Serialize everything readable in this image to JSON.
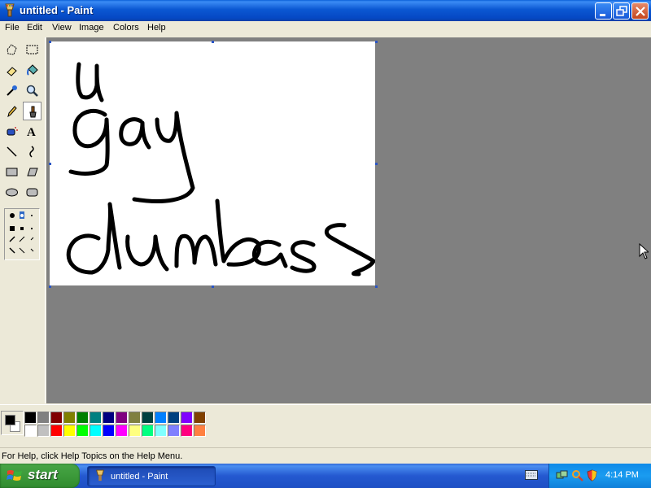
{
  "window": {
    "title": "untitled - Paint",
    "colors": {
      "titlebar": "#0b58d2",
      "close": "#c4451d"
    }
  },
  "menu": [
    "File",
    "Edit",
    "View",
    "Image",
    "Colors",
    "Help"
  ],
  "tools": [
    "free-form-select",
    "rectangle-select",
    "eraser",
    "fill-with-color",
    "pick-color",
    "magnifier",
    "pencil",
    "brush",
    "airbrush",
    "text",
    "line",
    "curve",
    "rectangle",
    "polygon",
    "ellipse",
    "rounded-rectangle"
  ],
  "active_tool": "brush",
  "canvas": {
    "drawing_words": [
      "u",
      "gay",
      "dumbass"
    ]
  },
  "colors": {
    "foreground": "#000000",
    "background": "#ffffff",
    "palette_row1": [
      "#000000",
      "#808080",
      "#800000",
      "#808000",
      "#008000",
      "#008080",
      "#000080",
      "#800080",
      "#808040",
      "#004040",
      "#0080ff",
      "#004080",
      "#8000ff",
      "#804000"
    ],
    "palette_row2": [
      "#ffffff",
      "#c0c0c0",
      "#ff0000",
      "#ffff00",
      "#00ff00",
      "#00ffff",
      "#0000ff",
      "#ff00ff",
      "#ffff80",
      "#00ff80",
      "#80ffff",
      "#8080ff",
      "#ff0080",
      "#ff8040"
    ]
  },
  "status": "For Help, click Help Topics on the Help Menu.",
  "taskbar": {
    "start": "start",
    "task": "untitled - Paint",
    "clock": "4:14 PM"
  }
}
